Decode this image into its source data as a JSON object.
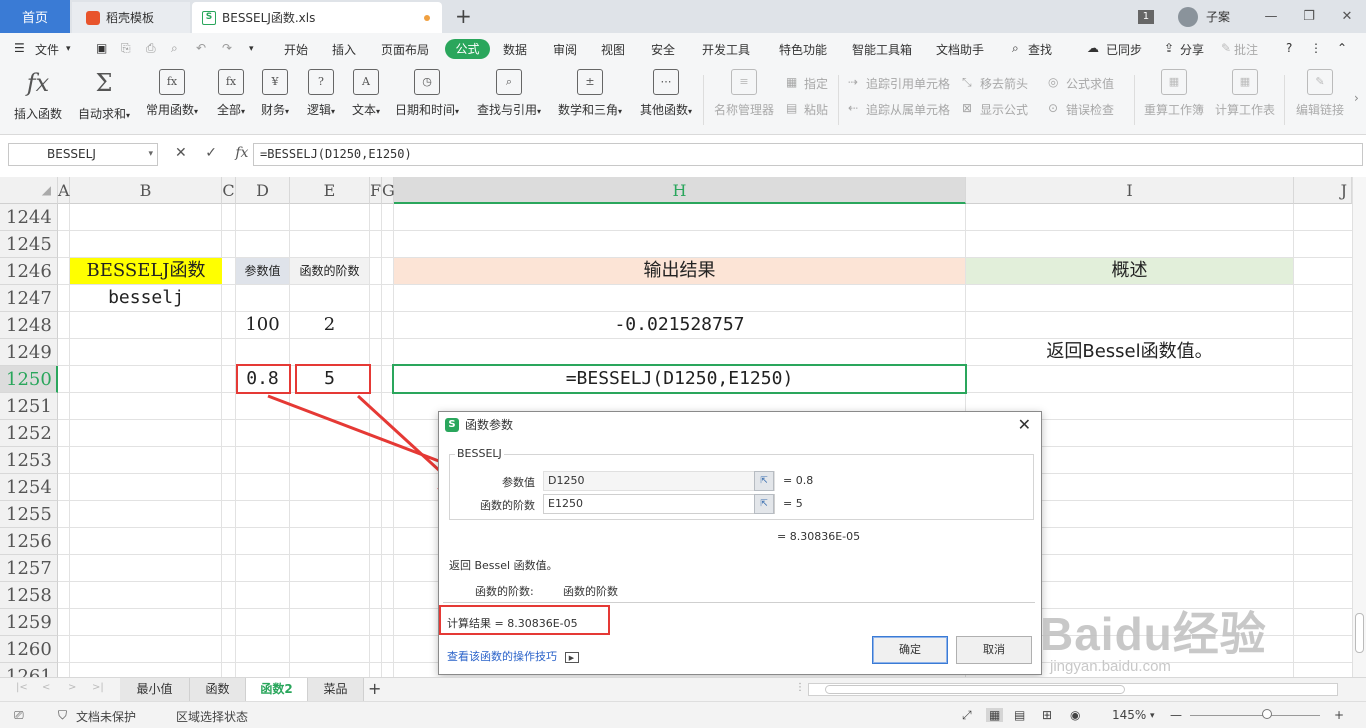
{
  "tabs": {
    "home": "首页",
    "daoke": "稻壳模板",
    "file": "BESSELJ函数.xls",
    "badge": "1",
    "user": "子案"
  },
  "menu": {
    "file": "文件",
    "items": [
      "开始",
      "插入",
      "页面布局",
      "公式",
      "数据",
      "审阅",
      "视图",
      "安全",
      "开发工具",
      "特色功能",
      "智能工具箱",
      "文档助手"
    ],
    "active": "公式",
    "search": "查找",
    "sync": "已同步",
    "share": "分享",
    "comment": "批注"
  },
  "ribbon": {
    "buttons": [
      "插入函数",
      "自动求和",
      "常用函数",
      "全部",
      "财务",
      "逻辑",
      "文本",
      "日期和时间",
      "查找与引用",
      "数学和三角",
      "其他函数",
      "名称管理器"
    ],
    "specify": "指定",
    "paste": "粘贴",
    "trace_precedents": "追踪引用单元格",
    "trace_dependents": "追踪从属单元格",
    "remove_arrows": "移去箭头",
    "show_formula": "显示公式",
    "eval_formula": "公式求值",
    "error_check": "错误检查",
    "recalc_workbook": "重算工作簿",
    "calc_sheet": "计算工作表",
    "edit_links": "编辑链接"
  },
  "formula_bar": {
    "name": "BESSELJ",
    "formula": "=BESSELJ(D1250,E1250)"
  },
  "columns": [
    "A",
    "B",
    "C",
    "D",
    "E",
    "F",
    "G",
    "H",
    "I",
    "J"
  ],
  "rows": [
    "1244",
    "1245",
    "1246",
    "1247",
    "1248",
    "1249",
    "1250",
    "1251",
    "1252",
    "1253",
    "1254",
    "1255",
    "1256",
    "1257",
    "1258",
    "1259",
    "1260",
    "1261"
  ],
  "cells": {
    "b1246": "BESSELJ函数",
    "b1247": "besselj",
    "d1246": "参数值",
    "e1246": "函数的阶数",
    "h1246": "输出结果",
    "i1246": "概述",
    "d1248": "100",
    "e1248": "2",
    "h1248": "-0.021528757",
    "i1249": "返回Bessel函数值。",
    "d1250": "0.8",
    "e1250": "5",
    "h1250": "=BESSELJ(D1250,E1250)"
  },
  "dialog": {
    "title": "函数参数",
    "func": "BESSELJ",
    "arg1_label": "参数值",
    "arg1_value": "D1250",
    "arg1_result": "= 0.8",
    "arg2_label": "函数的阶数",
    "arg2_value": "E1250",
    "arg2_result": "= 5",
    "total": "= 8.30836E-05",
    "desc": "返回 Bessel 函数值。",
    "param_label": "函数的阶数:",
    "param_desc": "函数的阶数",
    "calc_result": "计算结果  =  8.30836E-05",
    "link": "查看该函数的操作技巧",
    "ok": "确定",
    "cancel": "取消"
  },
  "sheets": [
    "最小值",
    "函数",
    "函数2",
    "菜品"
  ],
  "active_sheet": "函数2",
  "status": {
    "protect": "文档未保护",
    "selection": "区域选择状态",
    "zoom": "145%"
  },
  "watermark": {
    "logo": "Baidu经验",
    "url": "jingyan.baidu.com"
  },
  "colors": {
    "accent": "#2aa65c",
    "home_tab": "#3a7bd5",
    "highlight_yellow": "#ffff00",
    "header_peach": "#fce4d6",
    "header_green": "#e2efda",
    "annotation_red": "#e53935"
  }
}
